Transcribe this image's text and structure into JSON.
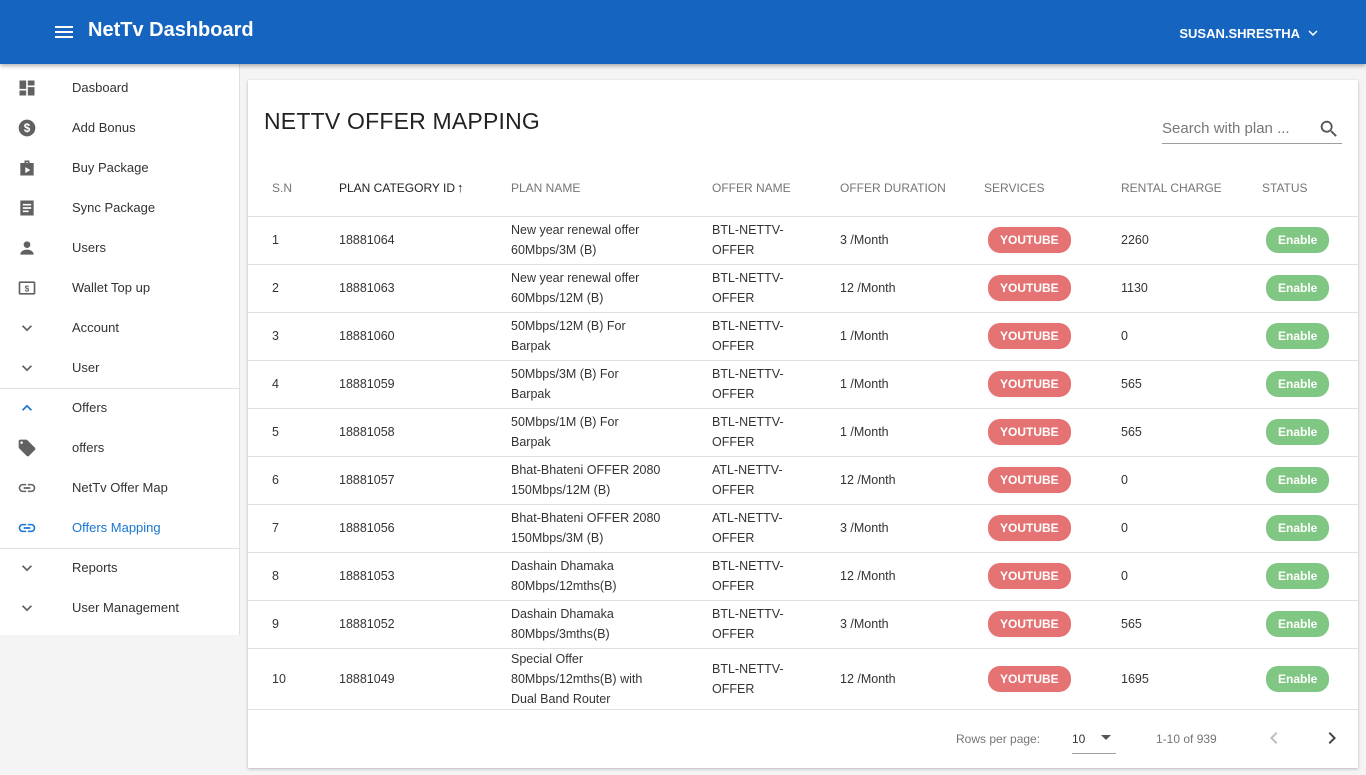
{
  "header": {
    "title": "NetTv Dashboard",
    "user": "SUSAN.SHRESTHA"
  },
  "sidebar": {
    "items": [
      {
        "label": "Dasboard",
        "icon": "dashboard-icon"
      },
      {
        "label": "Add Bonus",
        "icon": "dollar-icon"
      },
      {
        "label": "Buy Package",
        "icon": "package-icon"
      },
      {
        "label": "Sync Package",
        "icon": "list-icon"
      },
      {
        "label": "Users",
        "icon": "person-icon"
      },
      {
        "label": "Wallet Top up",
        "icon": "cash-icon"
      },
      {
        "label": "Account",
        "icon": "chevron-down-icon"
      },
      {
        "label": "User",
        "icon": "chevron-down-icon"
      },
      {
        "label": "Offers",
        "icon": "chevron-up-icon"
      },
      {
        "label": "offers",
        "icon": "tag-icon"
      },
      {
        "label": "NetTv Offer Map",
        "icon": "link-icon"
      },
      {
        "label": "Offers Mapping",
        "icon": "link-icon"
      },
      {
        "label": "Reports",
        "icon": "chevron-down-icon"
      },
      {
        "label": "User Management",
        "icon": "chevron-down-icon"
      }
    ],
    "active_index": 11,
    "accent": "#1976d2"
  },
  "page": {
    "title": "NETTV OFFER MAPPING",
    "search_placeholder": "Search with plan ..."
  },
  "table": {
    "columns": [
      "S.N",
      "PLAN CATEGORY ID",
      "PLAN NAME",
      "OFFER NAME",
      "OFFER DURATION",
      "SERVICES",
      "RENTAL CHARGE",
      "STATUS"
    ],
    "sort_arrow": "↑",
    "rows": [
      {
        "sn": "1",
        "id": "18881064",
        "plan": [
          "New year renewal offer",
          "60Mbps/3M (B)"
        ],
        "offer": [
          "BTL-NETTV-",
          "OFFER"
        ],
        "duration": "3 /Month",
        "service": "YOUTUBE",
        "rental": "2260",
        "status": "Enable"
      },
      {
        "sn": "2",
        "id": "18881063",
        "plan": [
          "New year renewal offer",
          "60Mbps/12M (B)"
        ],
        "offer": [
          "BTL-NETTV-",
          "OFFER"
        ],
        "duration": "12 /Month",
        "service": "YOUTUBE",
        "rental": "1130",
        "status": "Enable"
      },
      {
        "sn": "3",
        "id": "18881060",
        "plan": [
          "50Mbps/12M (B) For",
          "Barpak"
        ],
        "offer": [
          "BTL-NETTV-",
          "OFFER"
        ],
        "duration": "1 /Month",
        "service": "YOUTUBE",
        "rental": "0",
        "status": "Enable"
      },
      {
        "sn": "4",
        "id": "18881059",
        "plan": [
          "50Mbps/3M (B) For",
          "Barpak"
        ],
        "offer": [
          "BTL-NETTV-",
          "OFFER"
        ],
        "duration": "1 /Month",
        "service": "YOUTUBE",
        "rental": "565",
        "status": "Enable"
      },
      {
        "sn": "5",
        "id": "18881058",
        "plan": [
          "50Mbps/1M (B) For",
          "Barpak"
        ],
        "offer": [
          "BTL-NETTV-",
          "OFFER"
        ],
        "duration": "1 /Month",
        "service": "YOUTUBE",
        "rental": "565",
        "status": "Enable"
      },
      {
        "sn": "6",
        "id": "18881057",
        "plan": [
          "Bhat-Bhateni OFFER 2080",
          "150Mbps/12M (B)"
        ],
        "offer": [
          "ATL-NETTV-",
          "OFFER"
        ],
        "duration": "12 /Month",
        "service": "YOUTUBE",
        "rental": "0",
        "status": "Enable"
      },
      {
        "sn": "7",
        "id": "18881056",
        "plan": [
          "Bhat-Bhateni OFFER 2080",
          "150Mbps/3M (B)"
        ],
        "offer": [
          "ATL-NETTV-",
          "OFFER"
        ],
        "duration": "3 /Month",
        "service": "YOUTUBE",
        "rental": "0",
        "status": "Enable"
      },
      {
        "sn": "8",
        "id": "18881053",
        "plan": [
          "Dashain Dhamaka",
          "80Mbps/12mths(B)"
        ],
        "offer": [
          "BTL-NETTV-",
          "OFFER"
        ],
        "duration": "12 /Month",
        "service": "YOUTUBE",
        "rental": "0",
        "status": "Enable"
      },
      {
        "sn": "9",
        "id": "18881052",
        "plan": [
          "Dashain Dhamaka",
          "80Mbps/3mths(B)"
        ],
        "offer": [
          "BTL-NETTV-",
          "OFFER"
        ],
        "duration": "3 /Month",
        "service": "YOUTUBE",
        "rental": "565",
        "status": "Enable"
      },
      {
        "sn": "10",
        "id": "18881049",
        "plan": [
          "Special Offer",
          "80Mbps/12mths(B) with",
          "Dual Band Router"
        ],
        "offer": [
          "BTL-NETTV-",
          "OFFER"
        ],
        "duration": "12 /Month",
        "service": "YOUTUBE",
        "rental": "1695",
        "status": "Enable"
      }
    ]
  },
  "pagination": {
    "rows_per_page_label": "Rows per page:",
    "rows_per_page": "10",
    "range": "1-10 of 939"
  },
  "colors": {
    "appbar": "#1565c0",
    "service_pill": "#e57373",
    "status_pill": "#81c784"
  }
}
